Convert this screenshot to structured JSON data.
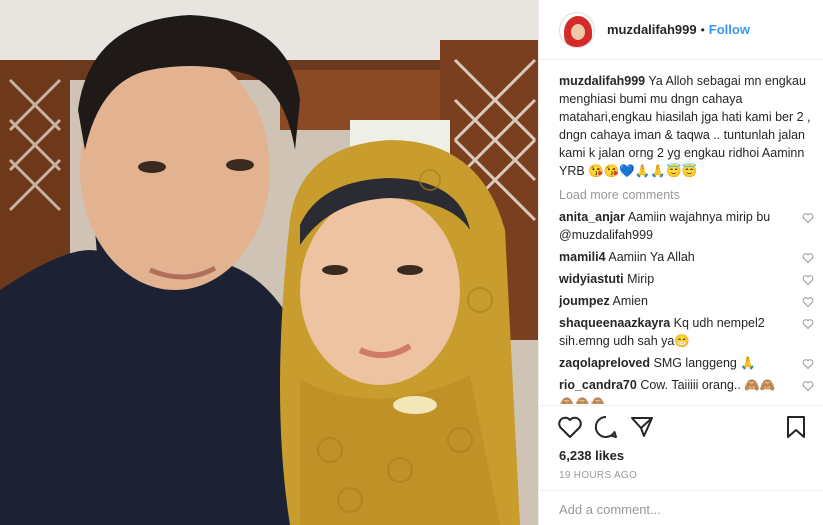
{
  "post": {
    "username": "muzdalifah999",
    "separator": "•",
    "follow_label": "Follow",
    "caption_user": "muzdalifah999",
    "caption_text": "Ya Alloh sebagai mn engkau menghiasi bumi mu dngn cahaya matahari,engkau hiasilah jga hati kami ber 2 , dngn cahaya iman & taqwa .. tuntunlah jalan kami k jalan orng 2 yg engkau ridhoi Aaminn YRB 😘😘💙🙏🙏😇😇",
    "load_more": "Load more comments",
    "comments": [
      {
        "user": "anita_anjar",
        "text": "Aamiin wajahnya mirip bu @muzdalifah999"
      },
      {
        "user": "mamili4",
        "text": "Aamiin Ya Allah"
      },
      {
        "user": "widyiastuti",
        "text": "Mirip"
      },
      {
        "user": "joumpez",
        "text": "Amien"
      },
      {
        "user": "shaqueenaazkayra",
        "text": "Kq udh nempel2 sih.emng udh sah ya😁"
      },
      {
        "user": "zaqolapreloved",
        "text": "SMG langgeng 🙏"
      },
      {
        "user": "rio_candra70",
        "text": "Cow. Taiiiii orang.. 🙈🙈 🙈🙈🙈"
      },
      {
        "user": "",
        "text": "🙈🙈🙈"
      }
    ],
    "likes": "6,238 likes",
    "time_ago": "19 HOURS AGO",
    "add_comment_placeholder": "Add a comment...",
    "icons": [
      "heart-icon",
      "comment-icon",
      "share-icon",
      "bookmark-icon"
    ],
    "colors": {
      "link": "#3897f0",
      "muted": "#999999",
      "text": "#262626",
      "border": "#efefef"
    }
  }
}
